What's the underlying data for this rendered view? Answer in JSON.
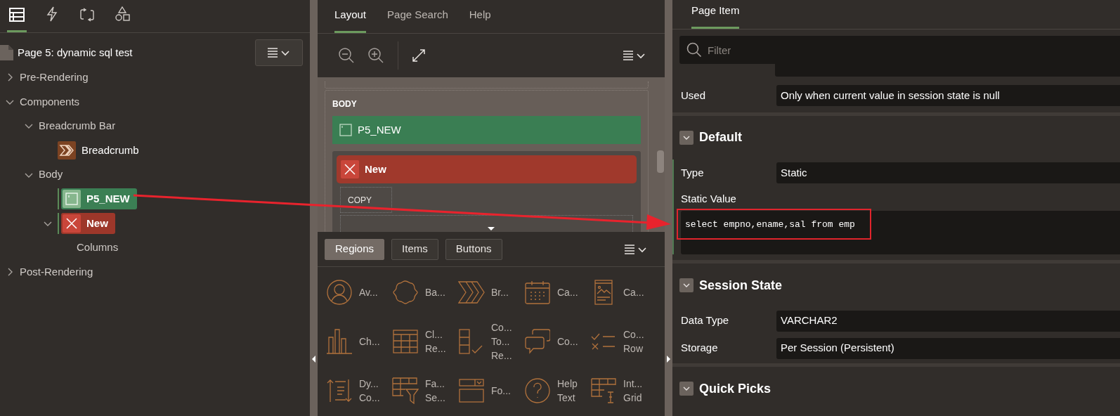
{
  "left_panel": {
    "tabs": [
      {
        "kind": "rendering",
        "selected": true
      },
      {
        "kind": "dynamic",
        "selected": false
      },
      {
        "kind": "processing",
        "selected": false
      },
      {
        "kind": "shared",
        "selected": false
      }
    ],
    "page_title": "Page 5: dynamic sql test",
    "tree": [
      {
        "label": "Pre-Rendering",
        "expanded": false
      },
      {
        "label": "Components",
        "expanded": true,
        "children": [
          {
            "label": "Breadcrumb Bar",
            "expanded": true,
            "children": [
              {
                "label": "Breadcrumb",
                "kind": "breadcrumb"
              }
            ]
          },
          {
            "label": "Body",
            "expanded": true,
            "children": [
              {
                "label": "P5_NEW",
                "kind": "item"
              },
              {
                "label": "New",
                "kind": "region",
                "expanded": true,
                "children": [
                  {
                    "label": "Columns"
                  }
                ]
              }
            ]
          }
        ]
      },
      {
        "label": "Post-Rendering",
        "expanded": false
      }
    ]
  },
  "layout_panel": {
    "tabs": [
      {
        "label": "Layout",
        "selected": true
      },
      {
        "label": "Page Search",
        "selected": false
      },
      {
        "label": "Help",
        "selected": false
      }
    ],
    "canvas": {
      "section_label": "BODY",
      "item_label": "P5_NEW",
      "region_label": "New",
      "button_label": "COPY"
    },
    "gallery_tabs": [
      {
        "label": "Regions",
        "selected": true
      },
      {
        "label": "Items",
        "selected": false
      },
      {
        "label": "Buttons",
        "selected": false
      }
    ],
    "gallery": [
      {
        "lines": [
          "Av..."
        ]
      },
      {
        "lines": [
          "Ba..."
        ]
      },
      {
        "lines": [
          "Br..."
        ]
      },
      {
        "lines": [
          "Ca..."
        ]
      },
      {
        "lines": [
          "Ca..."
        ]
      },
      {
        "lines": [
          "Ch..."
        ]
      },
      {
        "lines": [
          "Cl...",
          "Re..."
        ]
      },
      {
        "lines": [
          "Co...",
          "To...",
          "Re..."
        ]
      },
      {
        "lines": [
          "Co..."
        ]
      },
      {
        "lines": [
          "Co...",
          "Row"
        ]
      },
      {
        "lines": [
          "Dy...",
          "Co..."
        ]
      },
      {
        "lines": [
          "Fa...",
          "Se..."
        ]
      },
      {
        "lines": [
          "Fo..."
        ]
      },
      {
        "lines": [
          "Help",
          "Text"
        ]
      },
      {
        "lines": [
          "Int...",
          "Grid"
        ]
      }
    ]
  },
  "property_panel": {
    "tab": {
      "label": "Page Item",
      "selected": true
    },
    "filter": {
      "placeholder": "Filter"
    },
    "top_rows": [
      {
        "label": "Used",
        "value": "Only when current value in session state is null"
      }
    ],
    "sections": [
      {
        "title": "Default",
        "expanded": true,
        "changed": true,
        "rows": [
          {
            "label": "Type",
            "value": "Static",
            "kind": "field"
          },
          {
            "label": "Static Value",
            "value": "select empno,ename,sal from emp",
            "kind": "code"
          }
        ]
      },
      {
        "title": "Session State",
        "expanded": true,
        "rows": [
          {
            "label": "Data Type",
            "value": "VARCHAR2",
            "kind": "field"
          },
          {
            "label": "Storage",
            "value": "Per Session (Persistent)",
            "kind": "field"
          }
        ]
      },
      {
        "title": "Quick Picks",
        "expanded": true
      }
    ]
  }
}
